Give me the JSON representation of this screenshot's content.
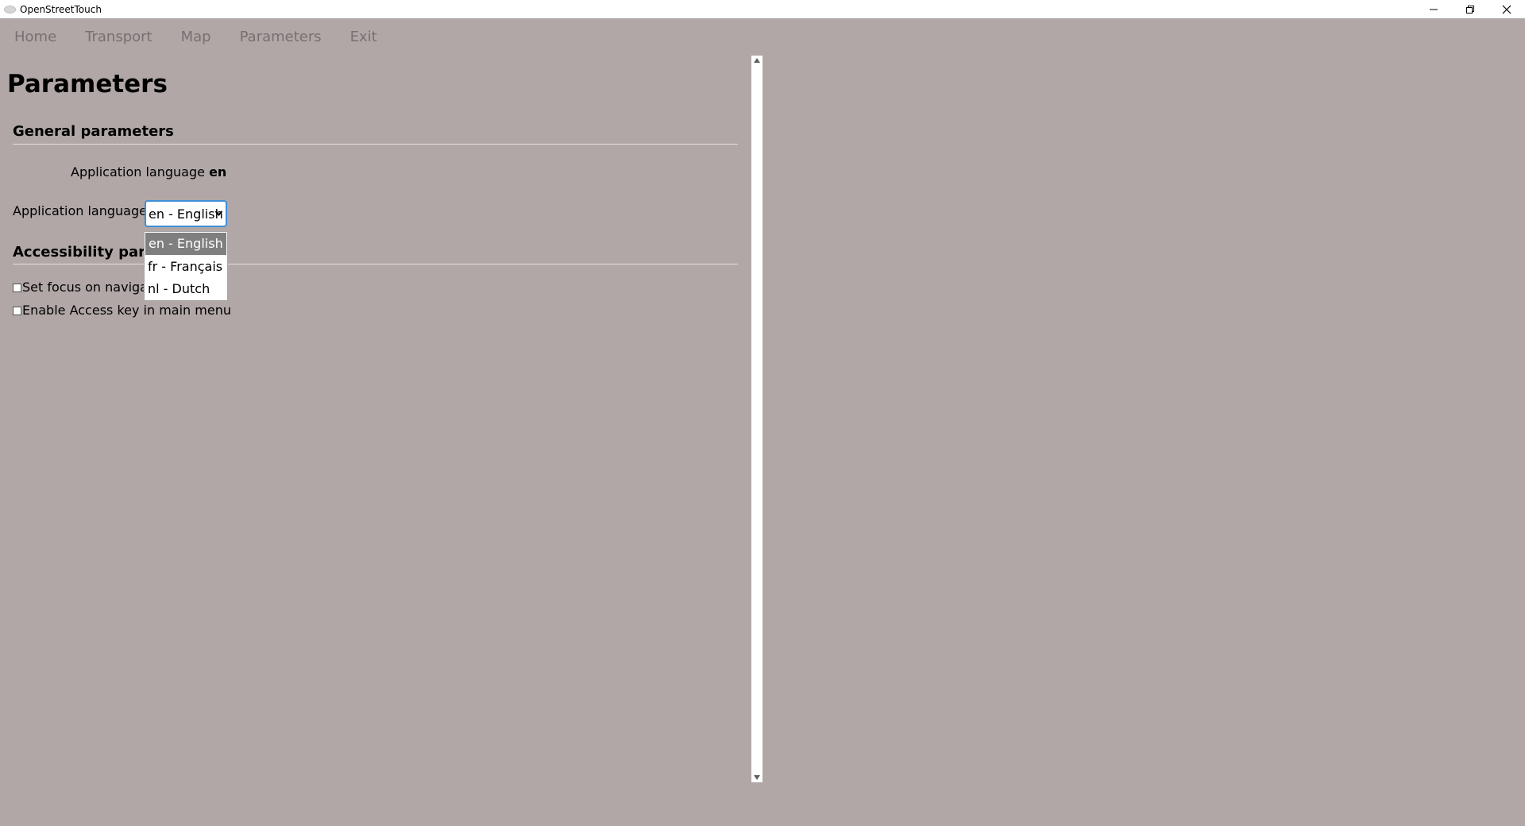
{
  "window": {
    "title": "OpenStreetTouch"
  },
  "menu": {
    "items": [
      {
        "label": "Home"
      },
      {
        "label": "Transport"
      },
      {
        "label": "Map"
      },
      {
        "label": "Parameters"
      },
      {
        "label": "Exit"
      }
    ]
  },
  "page": {
    "title": "Parameters",
    "general": {
      "heading": "General parameters",
      "current_language_label": "Application language",
      "current_language_value": "en",
      "language_select_label": "Application language",
      "language_select_value": "en - English",
      "language_options": [
        {
          "label": "en - English",
          "selected": true
        },
        {
          "label": "fr - Français",
          "selected": false
        },
        {
          "label": "nl - Dutch",
          "selected": false
        }
      ]
    },
    "accessibility": {
      "heading": "Accessibility parameters",
      "options": [
        {
          "label": "Set focus on navigate",
          "checked": false
        },
        {
          "label": "Enable Access key in main menu",
          "checked": false
        }
      ]
    }
  }
}
